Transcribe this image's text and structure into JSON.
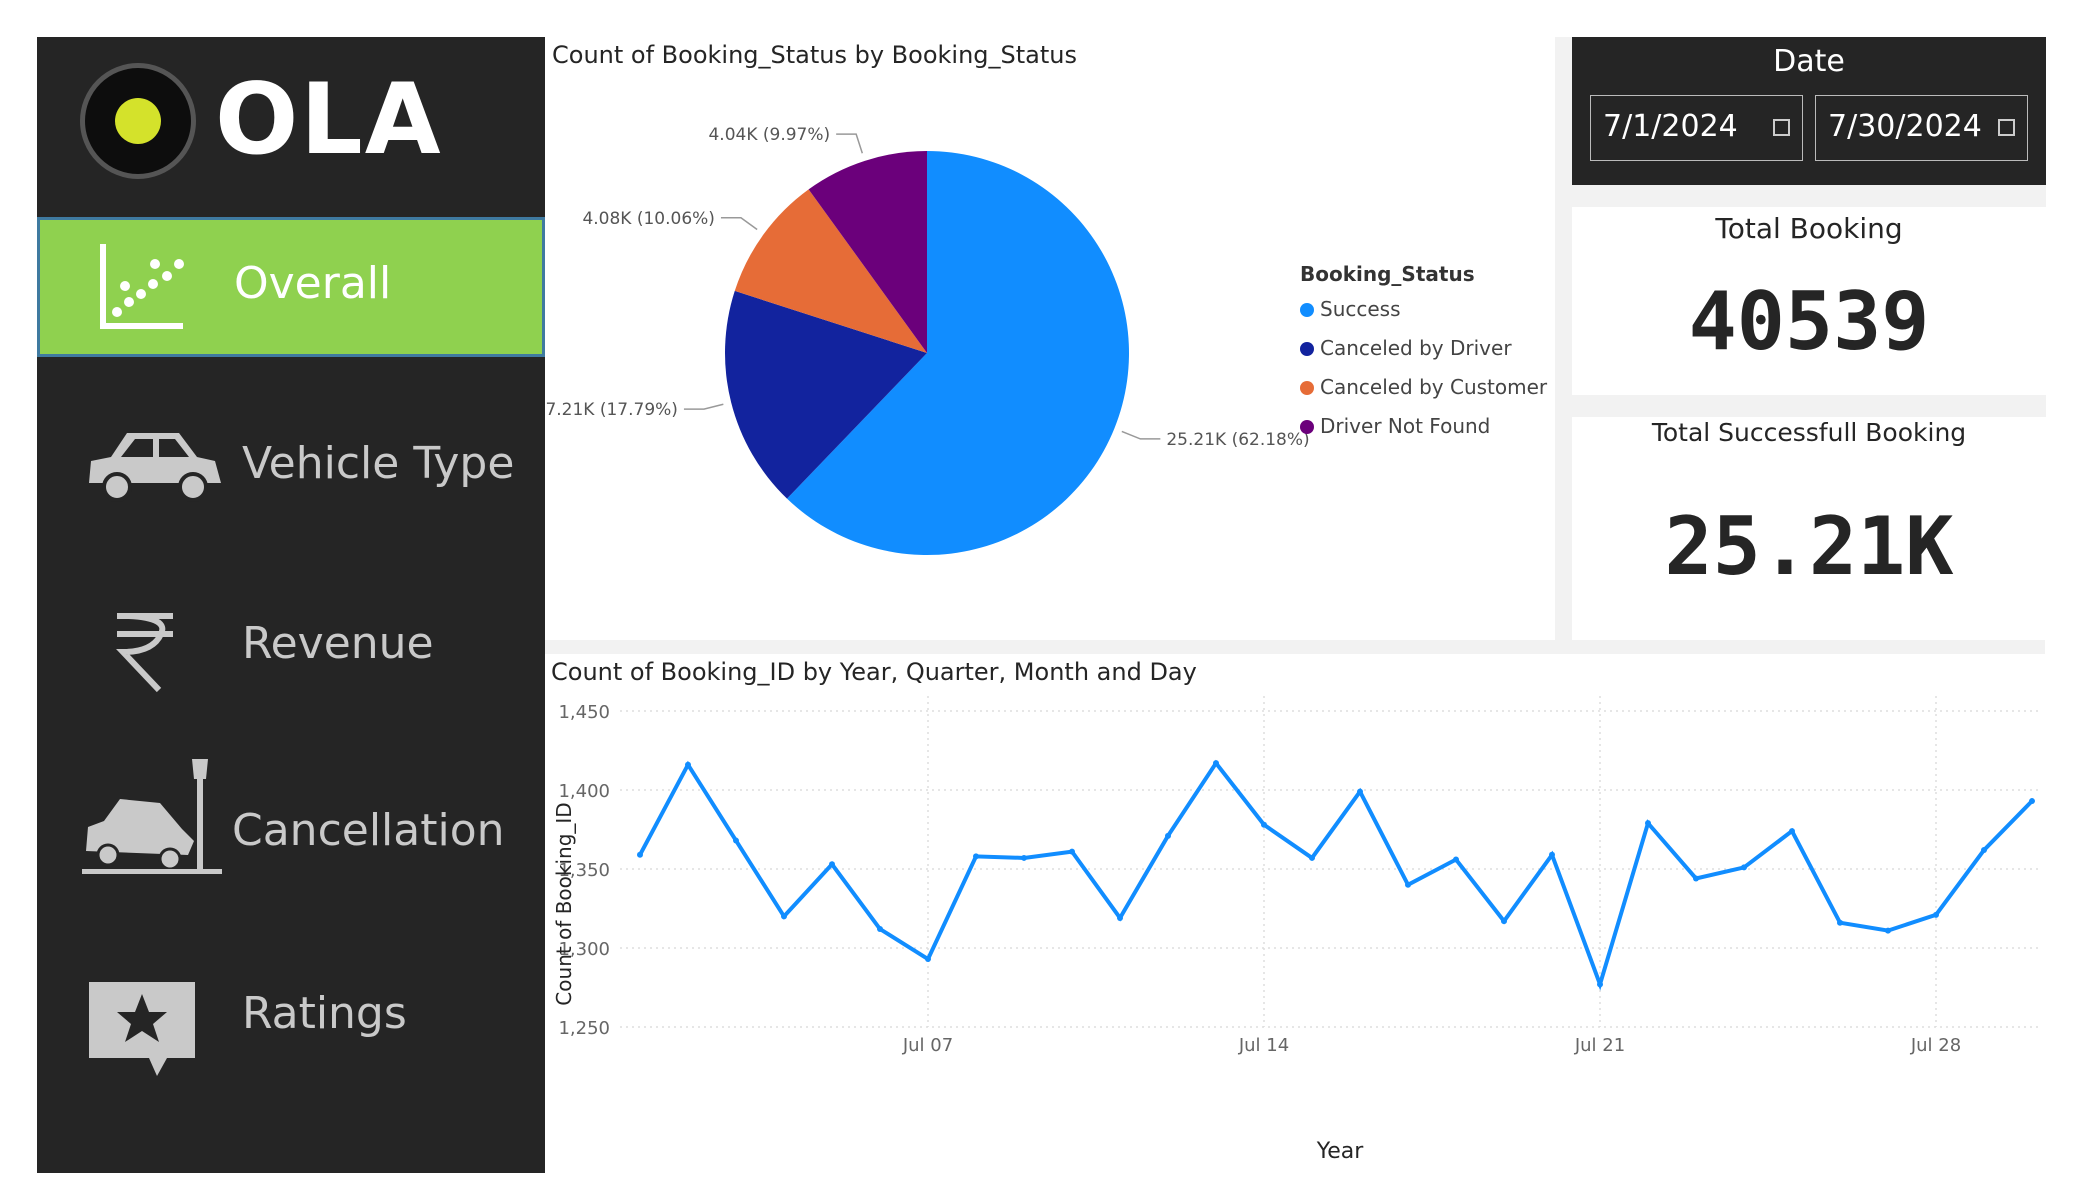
{
  "brand": {
    "logo_text": "OLA"
  },
  "sidebar": {
    "items": [
      {
        "label": "Overall",
        "icon": "scatter-chart-icon",
        "active": true
      },
      {
        "label": "Vehicle Type",
        "icon": "car-icon"
      },
      {
        "label": "Revenue",
        "icon": "rupee-icon"
      },
      {
        "label": "Cancellation",
        "icon": "car-crash-icon"
      },
      {
        "label": "Ratings",
        "icon": "star-comment-icon"
      }
    ]
  },
  "date_filter": {
    "title": "Date",
    "start": "7/1/2024",
    "end": "7/30/2024"
  },
  "kpis": {
    "total_booking": {
      "title": "Total Booking",
      "value": "40539"
    },
    "total_success": {
      "title": "Total Successfull Booking",
      "value": "25.21K"
    }
  },
  "colors": {
    "success": "#118DFF",
    "canceled_driver": "#12239E",
    "canceled_customer": "#E66C37",
    "driver_not_found": "#6B007B",
    "line": "#118DFF"
  },
  "chart_data": [
    {
      "type": "pie",
      "title": "Count of Booking_Status by Booking_Status",
      "legend_title": "Booking_Status",
      "legend_position": "right",
      "slices": [
        {
          "name": "Success",
          "value": 25210,
          "label": "25.21K (62.18%)"
        },
        {
          "name": "Canceled by Driver",
          "value": 7210,
          "label": "7.21K (17.79%)"
        },
        {
          "name": "Canceled by Customer",
          "value": 4080,
          "label": "4.08K (10.06%)"
        },
        {
          "name": "Driver Not Found",
          "value": 4040,
          "label": "4.04K (9.97%)"
        }
      ]
    },
    {
      "type": "line",
      "title": "Count of Booking_ID by Year, Quarter, Month and Day",
      "xlabel": "Year",
      "ylabel": "Count of Booking_ID",
      "ylim": [
        1250,
        1450
      ],
      "yticks": [
        1250,
        1300,
        1350,
        1400,
        1450
      ],
      "ytick_labels": [
        "1,250",
        "1,300",
        "1,350",
        "1,400",
        "1,450"
      ],
      "xtick_days": [
        7,
        14,
        21,
        28
      ],
      "xtick_labels": [
        "Jul 07",
        "Jul 14",
        "Jul 21",
        "Jul 28"
      ],
      "x": [
        1,
        2,
        3,
        4,
        5,
        6,
        7,
        8,
        9,
        10,
        11,
        12,
        13,
        14,
        15,
        16,
        17,
        18,
        19,
        20,
        21,
        22,
        23,
        24,
        25,
        26,
        27,
        28,
        29,
        30
      ],
      "values": [
        1359,
        1416,
        1368,
        1320,
        1353,
        1312,
        1293,
        1358,
        1357,
        1361,
        1319,
        1371,
        1417,
        1378,
        1357,
        1399,
        1340,
        1356,
        1317,
        1359,
        1277,
        1379,
        1344,
        1351,
        1374,
        1316,
        1311,
        1321,
        1362,
        1393
      ],
      "grid": true
    }
  ]
}
